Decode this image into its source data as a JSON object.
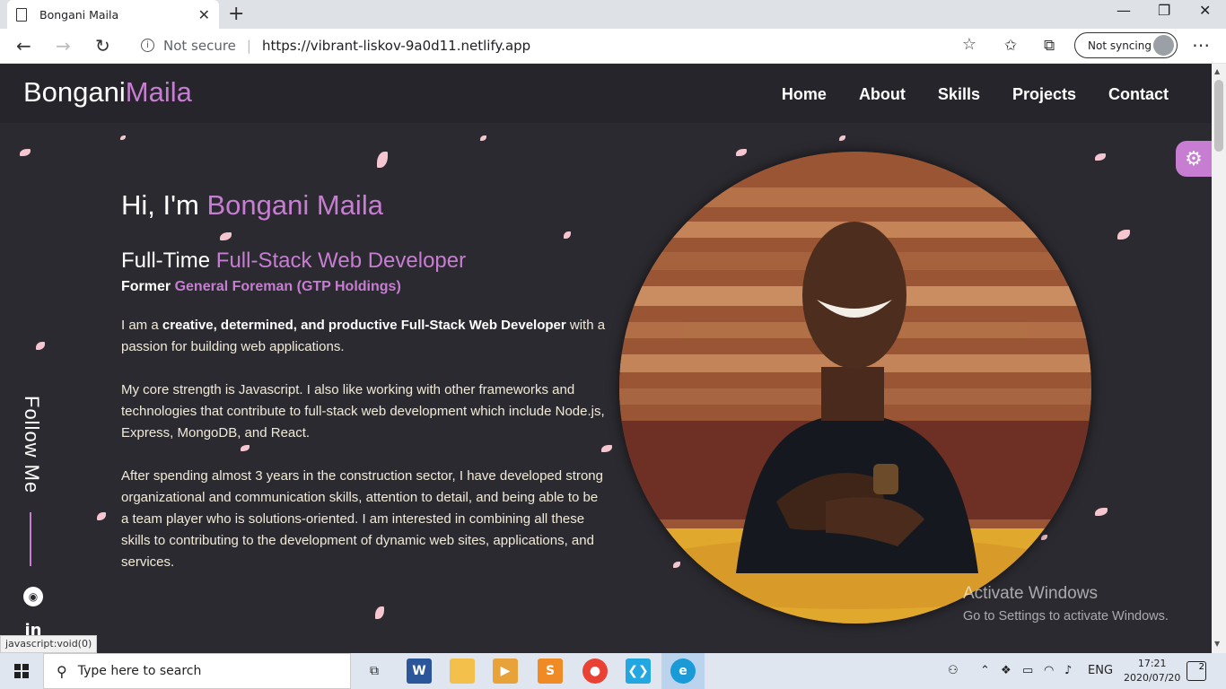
{
  "browser": {
    "tab_title": "Bongani Maila",
    "security_label": "Not secure",
    "url": "https://vibrant-liskov-9a0d11.netlify.app",
    "sync_label": "Not syncing",
    "status_tip": "javascript:void(0)"
  },
  "site": {
    "logo_first": "Bongani",
    "logo_last": "Maila",
    "nav": [
      "Home",
      "About",
      "Skills",
      "Projects",
      "Contact"
    ],
    "accent_color": "#c77dd1",
    "background_color": "#2a2a30"
  },
  "hero": {
    "greeting": "Hi, I'm",
    "name": "Bongani Maila",
    "role_prefix": "Full-Time",
    "role": "Full-Stack Web Developer",
    "former_prefix": "Former",
    "former": "General Foreman (GTP Holdings)",
    "para1_a": "I am a ",
    "para1_bold": "creative, determined, and productive Full-Stack Web Developer",
    "para1_b": " with a passion for building web applications.",
    "para2": "My core strength is Javascript. I also like working with other frameworks and technologies that contribute to full-stack web development which include Node.js, Express, MongoDB, and React.",
    "para3": "After spending almost 3 years in the construction sector, I have developed strong organizational and communication skills, attention to detail, and being able to be a team player who is solutions-oriented. I am interested in combining all these skills to contributing to the development of dynamic web sites, applications, and services."
  },
  "sidebar": {
    "follow_label": "Follow Me",
    "github_icon": "github-icon",
    "linkedin_icon": "linkedin-icon",
    "linkedin_glyph": "in"
  },
  "watermark": {
    "title": "Activate Windows",
    "subtitle": "Go to Settings to activate Windows."
  },
  "taskbar": {
    "search_placeholder": "Type here to search",
    "language": "ENG",
    "time": "17:21",
    "date": "2020/07/20",
    "notification_count": "2"
  }
}
